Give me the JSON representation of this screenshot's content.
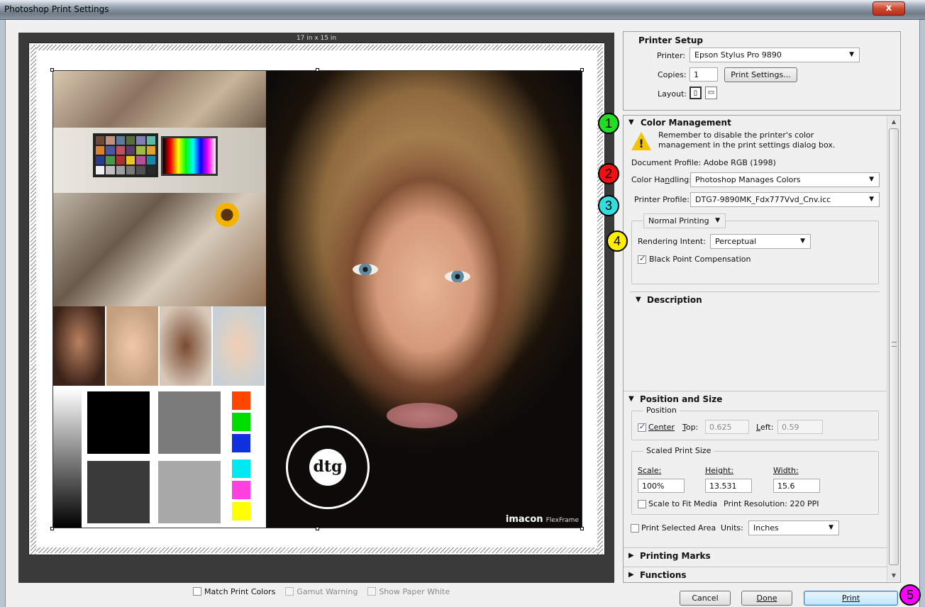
{
  "window": {
    "title": "Photoshop Print Settings",
    "close_label": "x"
  },
  "preview": {
    "paper_size": "17 in x 15 in",
    "logo_text": "dtg",
    "brand": "imacon",
    "brand_sub": "FlexFrame",
    "options": [
      {
        "label": "Match Print Colors",
        "checked": false,
        "enabled": true
      },
      {
        "label": "Gamut Warning",
        "checked": false,
        "enabled": false
      },
      {
        "label": "Show Paper White",
        "checked": false,
        "enabled": false
      }
    ]
  },
  "printer_setup": {
    "heading": "Printer Setup",
    "printer_label": "Printer:",
    "printer_value": "Epson Stylus Pro 9890",
    "copies_label": "Copies:",
    "copies_value": "1",
    "print_settings_button": "Print Settings...",
    "layout_label": "Layout:"
  },
  "color_management": {
    "heading": "Color Management",
    "warning_text_1": "Remember to disable the printer's color",
    "warning_text_2": "management in the print settings dialog box.",
    "document_profile": "Document Profile: Adobe RGB (1998)",
    "color_handling_label_pre": "Color Ha",
    "color_handling_label_u": "n",
    "color_handling_label_post": "dling:",
    "color_handling_value": "Photoshop Manages Colors",
    "printer_profile_label": "Printer Profile:",
    "printer_profile_value": "DTG7-9890MK_Fdx777Vvd_Cnv.icc",
    "printing_mode": "Normal Printing",
    "rendering_intent_label": "Rendering Intent:",
    "rendering_intent_value": "Perceptual",
    "bpc_label": "Black Point Compensation"
  },
  "description": {
    "heading": "Description"
  },
  "position_size": {
    "heading": "Position and Size",
    "position_group": "Position",
    "center_label": "Center",
    "top_label": "Top:",
    "top_value": "0.625",
    "left_label": "Left:",
    "left_value": "0.59",
    "scaled_group": "Scaled Print Size",
    "scale_label": "Scale:",
    "scale_value": "100%",
    "height_label": "Height:",
    "height_value": "13.531",
    "width_label": "Width:",
    "width_value": "15.6",
    "fit_media_label": "Scale to Fit Media",
    "print_resolution": "Print Resolution: 220 PPI",
    "print_selected_label": "Print Selected Area",
    "units_label": "Units:",
    "units_value": "Inches"
  },
  "collapsed_sections": {
    "printing_marks": "Printing Marks",
    "functions": "Functions"
  },
  "buttons": {
    "cancel": "Cancel",
    "done": "Done",
    "print": "Print"
  },
  "badges": [
    "1",
    "2",
    "3",
    "4",
    "5"
  ],
  "colors": {
    "badge_1": "#22dd22",
    "badge_2": "#ee1111",
    "badge_3": "#33dde0",
    "badge_4": "#ffee00",
    "badge_5": "#ff00ff",
    "close": "#c9442b"
  }
}
